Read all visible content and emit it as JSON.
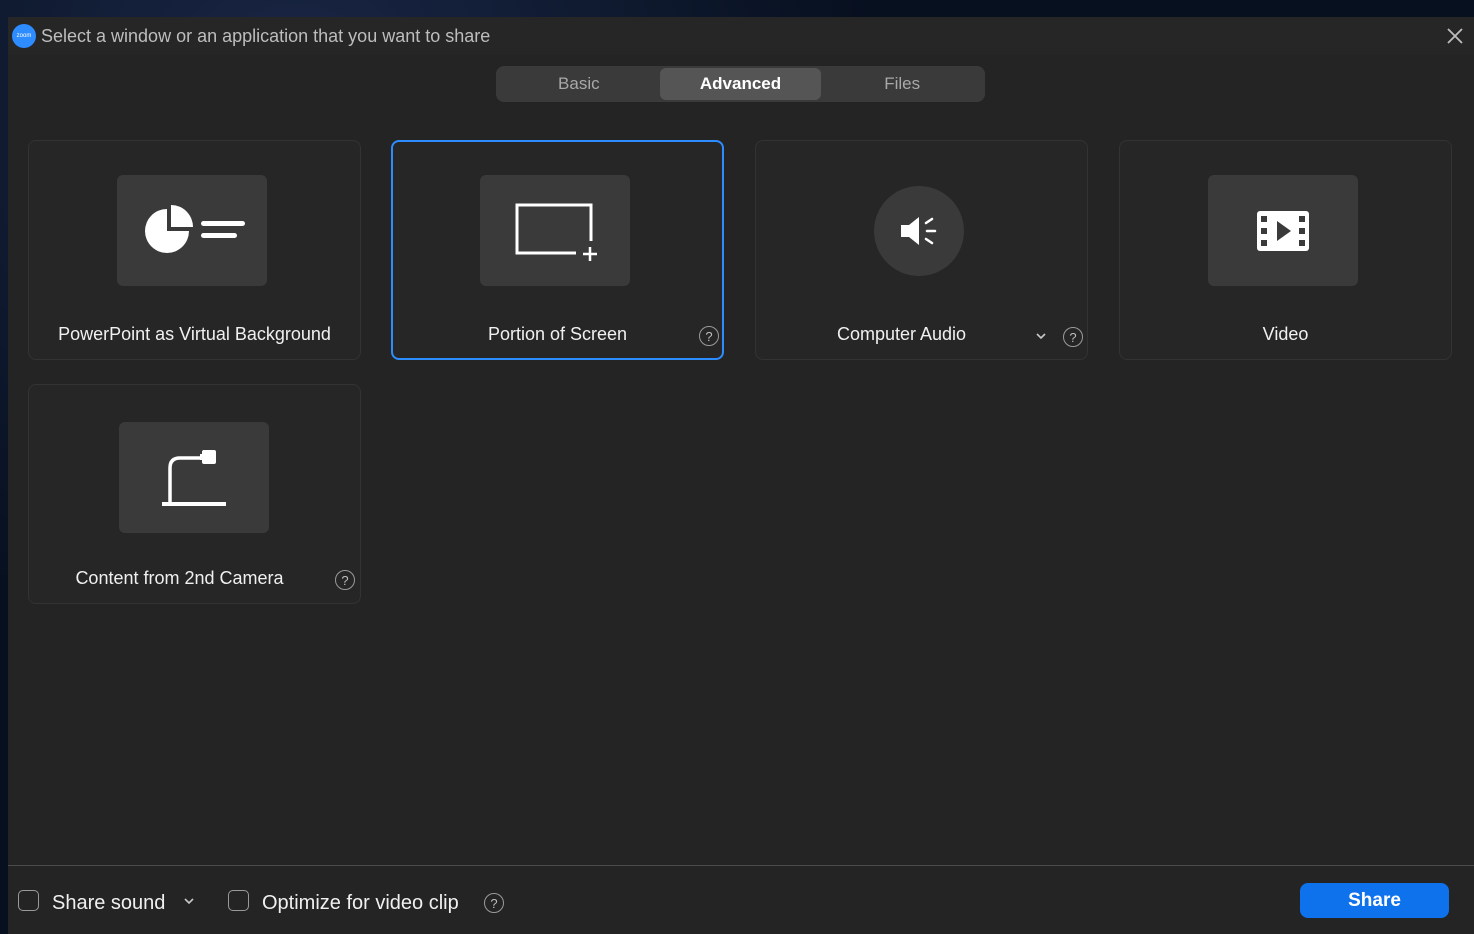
{
  "titlebar": {
    "logo_text": "zoom",
    "title": "Select a window or an application that you want to share"
  },
  "tabs": [
    {
      "label": "Basic",
      "active": false
    },
    {
      "label": "Advanced",
      "active": true
    },
    {
      "label": "Files",
      "active": false
    }
  ],
  "options": [
    {
      "label": "PowerPoint as Virtual Background",
      "icon": "powerpoint-chart-icon"
    },
    {
      "label": "Portion of Screen",
      "icon": "screen-portion-icon",
      "selected": true
    },
    {
      "label": "Computer Audio",
      "icon": "speaker-icon"
    },
    {
      "label": "Video",
      "icon": "video-film-icon"
    },
    {
      "label": "Content from 2nd Camera",
      "icon": "document-camera-icon"
    }
  ],
  "help_glyph": "?",
  "footer": {
    "share_sound_label": "Share sound",
    "optimize_label": "Optimize for video clip",
    "share_button": "Share"
  },
  "colors": {
    "accent": "#2d8cff",
    "share_button": "#0e72ed",
    "background": "#242424"
  }
}
